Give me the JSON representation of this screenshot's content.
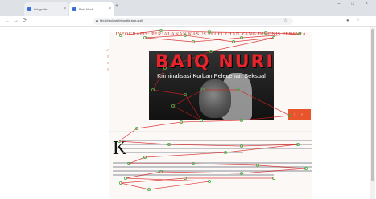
{
  "browser": {
    "tabs": [
      {
        "label": "Infografis"
      },
      {
        "label": "Baiq Nuril"
      }
    ],
    "new_tab": "+",
    "window_controls": "– □ ×",
    "nav": {
      "back": "←",
      "forward": "→",
      "reload": "⟳"
    },
    "url": "kbr.id/nasional/infografis-baiq-nuril",
    "star": "☆"
  },
  "article": {
    "title": "INFOGRAFIS: PERJALANAN KASUS PELECEHAN YANG DIVONIS PENJARA",
    "share_icons": [
      "share-facebook-icon",
      "share-twitter-icon",
      "share-whatsapp-icon",
      "share-email-icon"
    ],
    "hero": {
      "sign_title": "BAIQ NURIL",
      "sign_subtitle": "Kriminalisasi Korban Pelecehan Seksual"
    },
    "next_label": "› ›",
    "dropcap": "K"
  },
  "colors": {
    "accent": "#c0392b",
    "button": "#e8542c",
    "gaze_path": "#d62020",
    "gaze_point": "#3cb043"
  }
}
